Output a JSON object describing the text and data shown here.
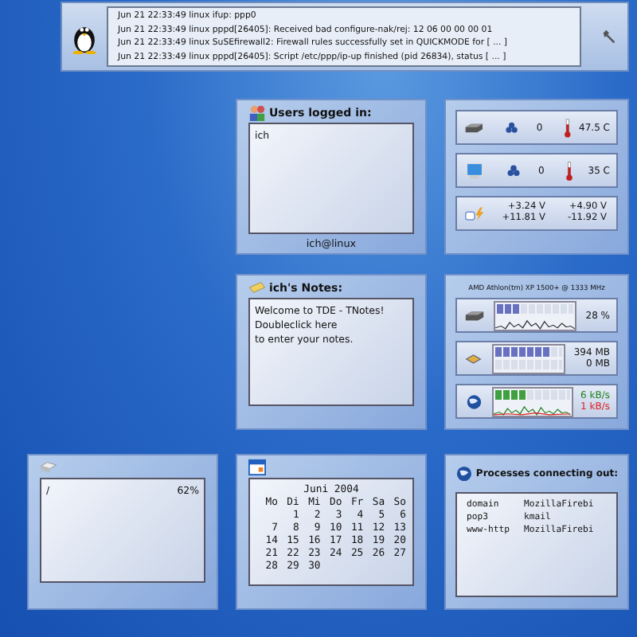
{
  "log_panel": {
    "lines": [
      "Jun 21 22:33:49 linux ifup:     ppp0",
      "Jun 21 22:33:49 linux pppd[26405]: Received bad configure-nak/rej:  12 06 00 00 00 01",
      "Jun 21 22:33:49 linux SuSEfirewall2: Firewall rules successfully set in QUICKMODE for    [ ... ]",
      "Jun 21 22:33:49 linux pppd[26405]: Script /etc/ppp/ip-up finished (pid 26834), status    [ ... ]"
    ]
  },
  "users_widget": {
    "title": "Users logged in:",
    "users": [
      "ich"
    ],
    "footer": "ich@linux"
  },
  "sensors_widget": {
    "rows": [
      {
        "kind": "disk",
        "fan": "0",
        "temp": "47.5 C"
      },
      {
        "kind": "monitor",
        "fan": "0",
        "temp": "35 C"
      }
    ],
    "voltages": [
      "+3.24 V",
      "+4.90 V",
      "+11.81 V",
      "-11.92 V"
    ]
  },
  "notes_widget": {
    "title": "ich's Notes:",
    "lines": [
      "Welcome to TDE - TNotes!",
      "Doubleclick here",
      "to enter your notes."
    ]
  },
  "system_widget": {
    "title": "AMD Athlon(tm) XP 1500+ @ 1333 MHz",
    "cpu": {
      "level": 0.3,
      "reading": "28 %"
    },
    "memory": {
      "ram": {
        "level": 0.8,
        "reading": "394 MB"
      },
      "swap": {
        "level": 0,
        "reading": "0 MB"
      }
    },
    "network": {
      "level": 0.4,
      "in": "6 kB/s",
      "out": "1 kB/s"
    }
  },
  "disk_widget": {
    "mount": "/",
    "usage": "62%"
  },
  "calendar_widget": {
    "month": "Juni 2004",
    "weekdays": [
      "Mo",
      "Di",
      "Mi",
      "Do",
      "Fr",
      "Sa",
      "So"
    ],
    "weeks": [
      [
        "1",
        "2",
        "3",
        "4",
        "5",
        "6"
      ],
      [
        "7",
        "8",
        "9",
        "10",
        "11",
        "12",
        "13"
      ],
      [
        "14",
        "15",
        "16",
        "17",
        "18",
        "19",
        "20"
      ],
      [
        "21",
        "22",
        "23",
        "24",
        "25",
        "26",
        "27"
      ],
      [
        "28",
        "29",
        "30"
      ]
    ]
  },
  "processes_widget": {
    "title": "Processes connecting out:",
    "rows": [
      [
        "domain",
        "MozillaFirebi"
      ],
      [
        "pop3",
        "kmail"
      ],
      [
        "www-http",
        "MozillaFirebi"
      ]
    ]
  }
}
